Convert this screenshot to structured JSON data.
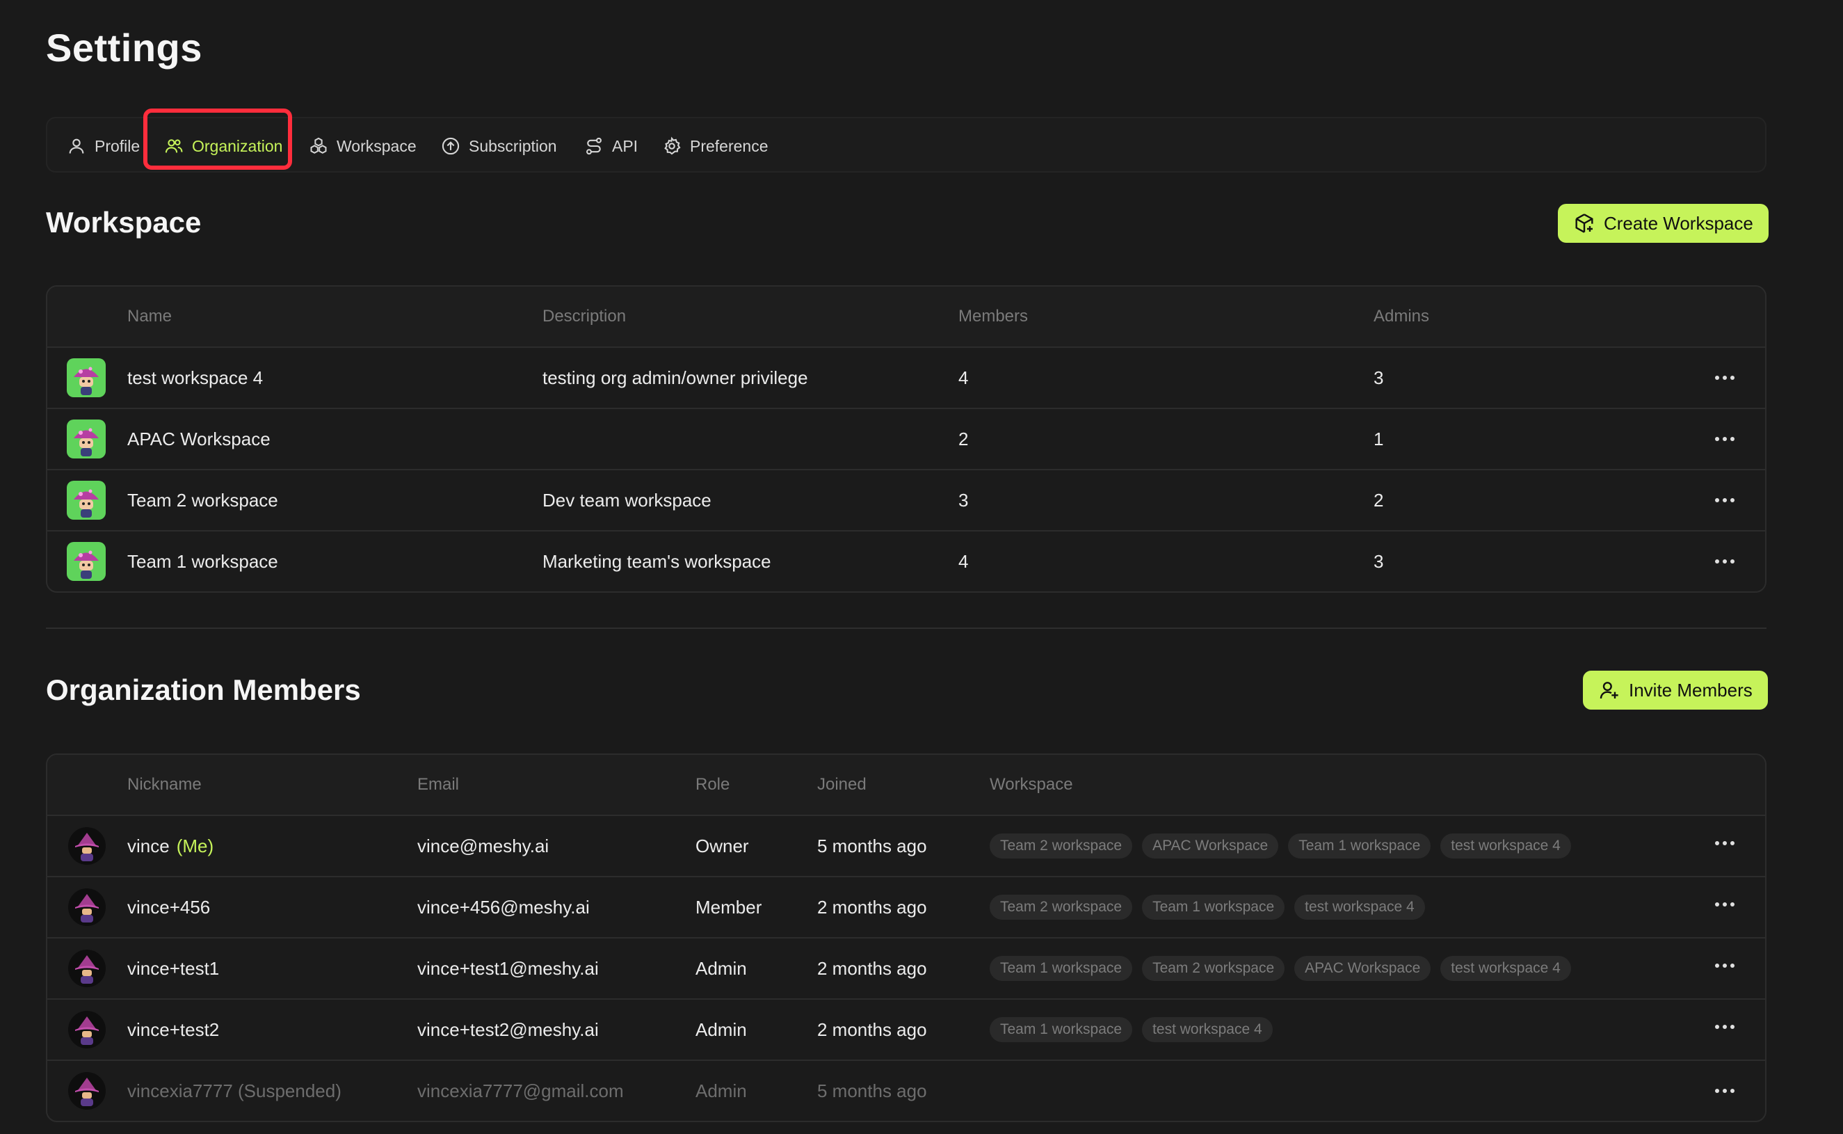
{
  "page": {
    "title": "Settings"
  },
  "tabs": [
    {
      "label": "Profile",
      "icon": "user-icon",
      "active": false
    },
    {
      "label": "Organization",
      "icon": "users-icon",
      "active": true
    },
    {
      "label": "Workspace",
      "icon": "cubes-icon",
      "active": false
    },
    {
      "label": "Subscription",
      "icon": "arrow-up-circle-icon",
      "active": false
    },
    {
      "label": "API",
      "icon": "route-icon",
      "active": false
    },
    {
      "label": "Preference",
      "icon": "gear-icon",
      "active": false
    }
  ],
  "workspace_section": {
    "title": "Workspace",
    "create_label": "Create Workspace",
    "columns": [
      "Name",
      "Description",
      "Members",
      "Admins"
    ],
    "rows": [
      {
        "name": "test workspace 4",
        "description": "testing org admin/owner privilege",
        "members": "4",
        "admins": "3"
      },
      {
        "name": "APAC Workspace",
        "description": "",
        "members": "2",
        "admins": "1"
      },
      {
        "name": "Team 2 workspace",
        "description": "Dev team workspace",
        "members": "3",
        "admins": "2"
      },
      {
        "name": "Team 1 workspace",
        "description": "Marketing team's workspace",
        "members": "4",
        "admins": "3"
      }
    ]
  },
  "members_section": {
    "title": "Organization Members",
    "invite_label": "Invite Members",
    "columns": [
      "Nickname",
      "Email",
      "Role",
      "Joined",
      "Workspace"
    ],
    "rows": [
      {
        "nickname": "vince",
        "tag": "(Me)",
        "email": "vince@meshy.ai",
        "role": "Owner",
        "joined": "5 months ago",
        "workspaces": [
          "Team 2 workspace",
          "APAC Workspace",
          "Team 1 workspace",
          "test workspace 4"
        ]
      },
      {
        "nickname": "vince+456",
        "tag": "",
        "email": "vince+456@meshy.ai",
        "role": "Member",
        "joined": "2 months ago",
        "workspaces": [
          "Team 2 workspace",
          "Team 1 workspace",
          "test workspace 4"
        ]
      },
      {
        "nickname": "vince+test1",
        "tag": "",
        "email": "vince+test1@meshy.ai",
        "role": "Admin",
        "joined": "2 months ago",
        "workspaces": [
          "Team 1 workspace",
          "Team 2 workspace",
          "APAC Workspace",
          "test workspace 4"
        ]
      },
      {
        "nickname": "vince+test2",
        "tag": "",
        "email": "vince+test2@meshy.ai",
        "role": "Admin",
        "joined": "2 months ago",
        "workspaces": [
          "Team 1 workspace",
          "test workspace 4"
        ]
      },
      {
        "nickname": "vincexia7777 (Suspended)",
        "tag": "",
        "email": "vincexia7777@gmail.com",
        "role": "Admin",
        "joined": "5 months ago",
        "workspaces": [],
        "suspended": true
      }
    ]
  },
  "colors": {
    "background": "#1a1a1a",
    "accent": "#c6f35a",
    "highlight": "#ff2d3c",
    "chip_background": "#2a2a2a",
    "workspace_avatar": "#5fd35b"
  }
}
